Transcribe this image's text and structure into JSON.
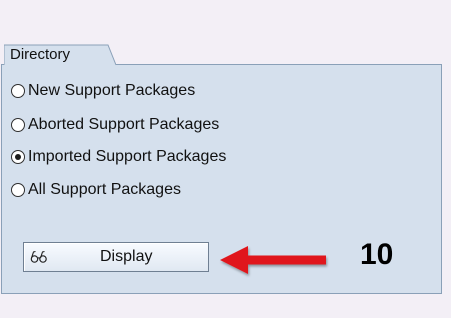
{
  "directory": {
    "title": "Directory",
    "options": [
      {
        "label": "New Support Packages",
        "checked": false
      },
      {
        "label": "Aborted Support Packages",
        "checked": false
      },
      {
        "label": "Imported Support Packages",
        "checked": true
      },
      {
        "label": "All Support Packages",
        "checked": false
      }
    ]
  },
  "display_button": {
    "label": "Display",
    "icon": "glasses-icon"
  },
  "annotation": {
    "step_number": "10",
    "arrow_color": "#e0191e"
  }
}
